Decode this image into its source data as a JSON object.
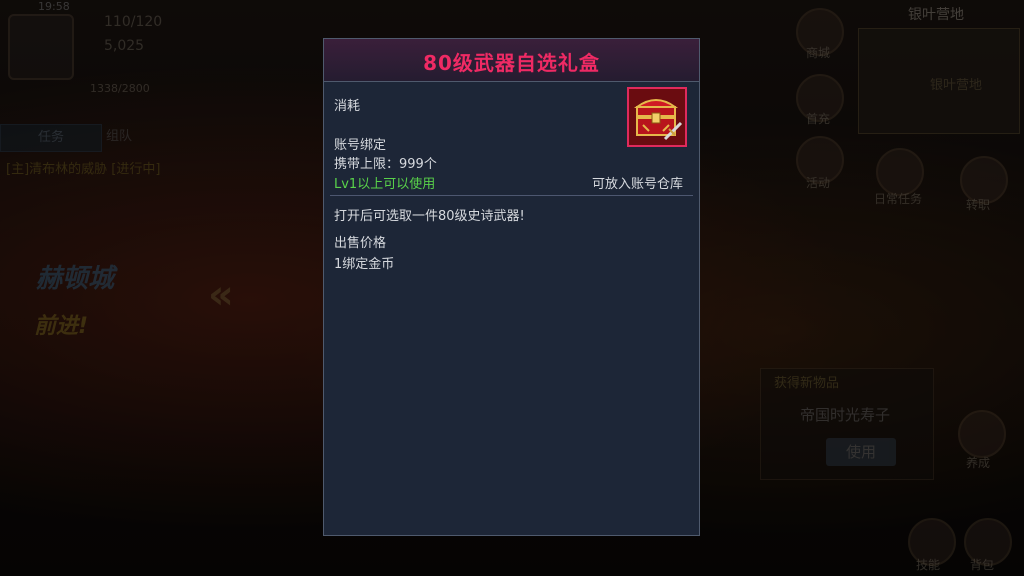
{
  "hud": {
    "time": "19:58",
    "fatigue": "110/120",
    "gold": "5,025",
    "exp": "1338/2800",
    "quest_tab": "任务",
    "team_tab": "组队",
    "quest_line": "[主]清布林的威胁 [进行中]",
    "city": "赫顿城",
    "forward": "前进!",
    "chevrons": "«",
    "region_title": "银叶营地",
    "region_map_label": "银叶营地"
  },
  "right_side": {
    "labels": [
      "商城",
      "活动",
      "首充",
      "日常任务",
      "转职",
      "养成",
      "技能",
      "背包"
    ]
  },
  "new_item_popup": {
    "title": "获得新物品",
    "item_name": "帝国时光寿子",
    "use_label": "使用"
  },
  "tooltip": {
    "title": "80级武器自选礼盒",
    "title_color": "#ef2a64",
    "category": "消耗",
    "bind": "账号绑定",
    "stack_limit": "携带上限：999个",
    "level_req": "Lv1以上可以使用",
    "level_req_color": "#59d24a",
    "storage": "可放入账号仓库",
    "description": "打开后可选取一件80级史诗武器!",
    "sell_label": "出售价格",
    "sell_value": "1绑定金币",
    "icon": "treasure-chest-icon"
  }
}
